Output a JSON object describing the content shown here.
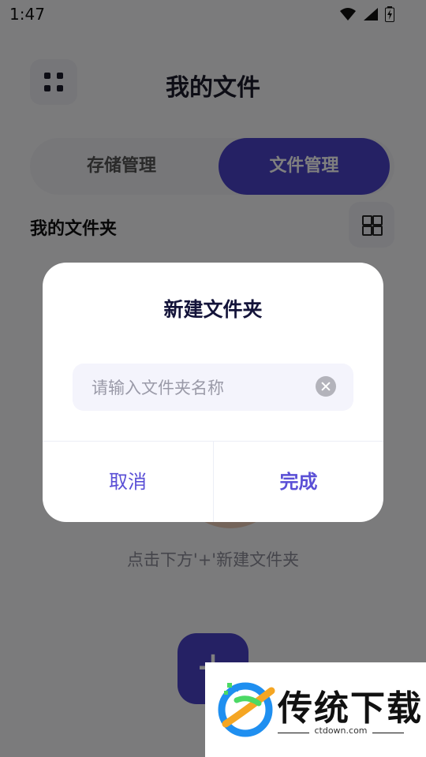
{
  "status_bar": {
    "time": "1:47"
  },
  "header": {
    "title": "我的文件"
  },
  "tabs": [
    {
      "label": "存储管理"
    },
    {
      "label": "文件管理",
      "active": true
    }
  ],
  "section": {
    "title": "我的文件夹"
  },
  "empty_state": {
    "hint": "点击下方'+'新建文件夹"
  },
  "fab": {
    "label": "+"
  },
  "dialog": {
    "title": "新建文件夹",
    "input_placeholder": "请输入文件夹名称",
    "input_value": "",
    "cancel_label": "取消",
    "done_label": "完成"
  },
  "watermark": {
    "text": "传统下载",
    "url": "ctdown.com"
  },
  "colors": {
    "accent": "#4b43c8",
    "dialog_button": "#5a4fd6",
    "overlay": "rgba(0,0,0,0.5)"
  }
}
